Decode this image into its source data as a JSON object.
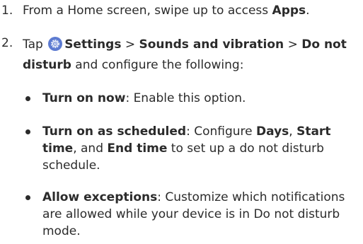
{
  "steps": [
    {
      "number": "1.",
      "parts": [
        {
          "text": "From a Home screen, swipe up to access ",
          "bold": false
        },
        {
          "text": "Apps",
          "bold": true
        },
        {
          "text": ".",
          "bold": false
        }
      ]
    },
    {
      "number": "2.",
      "parts": [
        {
          "text": "Tap ",
          "bold": false
        },
        {
          "icon": "settings-gear-icon"
        },
        {
          "text": "Settings",
          "bold": true
        },
        {
          "text": " > ",
          "bold": false
        },
        {
          "text": "Sounds and vibration",
          "bold": true
        },
        {
          "text": " > ",
          "bold": false
        },
        {
          "text": "Do not disturb",
          "bold": true
        },
        {
          "text": " and configure the following:",
          "bold": false
        }
      ]
    }
  ],
  "bullets": [
    {
      "parts": [
        {
          "text": "Turn on now",
          "bold": true
        },
        {
          "text": ": Enable this option.",
          "bold": false
        }
      ]
    },
    {
      "parts": [
        {
          "text": "Turn on as scheduled",
          "bold": true
        },
        {
          "text": ": Configure ",
          "bold": false
        },
        {
          "text": "Days",
          "bold": true
        },
        {
          "text": ", ",
          "bold": false
        },
        {
          "text": "Start time",
          "bold": true
        },
        {
          "text": ", and ",
          "bold": false
        },
        {
          "text": "End time",
          "bold": true
        },
        {
          "text": " to set up a do not disturb schedule.",
          "bold": false
        }
      ]
    },
    {
      "parts": [
        {
          "text": "Allow exceptions",
          "bold": true
        },
        {
          "text": ": Customize which notifications are allowed while your device is in Do not disturb mode.",
          "bold": false
        }
      ]
    }
  ],
  "colors": {
    "text": "#2b2b2b",
    "settings_icon": "#5d7bd1"
  }
}
